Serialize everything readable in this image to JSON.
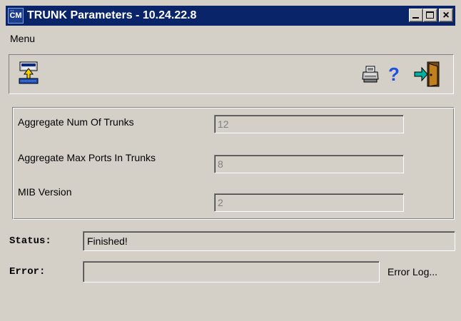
{
  "window": {
    "app_icon_text": "CM",
    "title": "TRUNK Parameters - 10.24.22.8"
  },
  "menu": {
    "items": [
      {
        "label": "Menu"
      }
    ]
  },
  "toolbar": {
    "icons": [
      "upload-icon",
      "print-icon",
      "help-icon",
      "exit-icon"
    ],
    "help_glyph": "?"
  },
  "parameters": {
    "fields": [
      {
        "label": "Aggregate Num Of Trunks",
        "value": "12"
      },
      {
        "label": "Aggregate Max Ports In Trunks",
        "value": "8"
      },
      {
        "label": "MIB Version",
        "value": "2"
      }
    ]
  },
  "status": {
    "label": "Status:",
    "value": "Finished!"
  },
  "error": {
    "label": "Error:",
    "value": "",
    "log_link": "Error Log..."
  },
  "colors": {
    "titlebar": "#0a246a",
    "face": "#d4d0c8",
    "help": "#1a4fe0"
  }
}
